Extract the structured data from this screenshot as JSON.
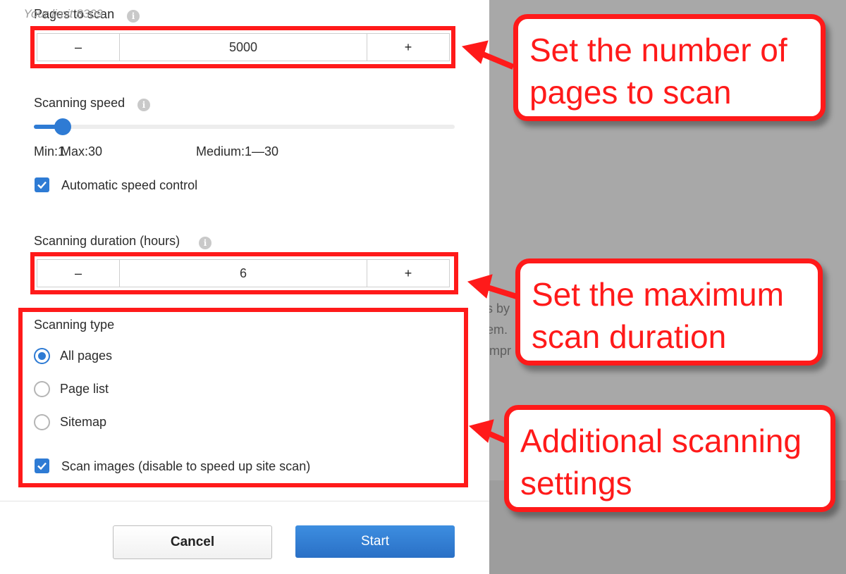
{
  "pages_to_scan": {
    "label": "Pages to scan",
    "limit_text": "Your limit 8309",
    "decrement_label": "–",
    "value": "5000",
    "increment_label": "+"
  },
  "scanning_speed": {
    "label": "Scanning speed",
    "level": 1,
    "min_label": "Min:1",
    "medium_label": "Medium:1—30",
    "max_label": "Max:30",
    "auto_label": "Automatic speed control",
    "auto_checked": true
  },
  "scanning_duration": {
    "label": "Scanning duration (hours)",
    "decrement_label": "–",
    "value": "6",
    "increment_label": "+"
  },
  "scanning_type": {
    "label": "Scanning type",
    "options": [
      {
        "label": "All pages",
        "selected": true
      },
      {
        "label": "Page list",
        "selected": false
      },
      {
        "label": "Sitemap",
        "selected": false
      }
    ],
    "scan_images_label": "Scan images (disable to speed up site scan)",
    "scan_images_checked": true
  },
  "footer": {
    "cancel_label": "Cancel",
    "start_label": "Start"
  },
  "background_text": [
    "s by",
    "em.",
    "impr"
  ],
  "callouts": {
    "pages": [
      "Set the number of",
      "pages to scan"
    ],
    "duration": [
      "Set the maximum",
      "scan duration"
    ],
    "settings": [
      "Additional scanning",
      "settings"
    ]
  },
  "colors": {
    "accent": "#2e7bd4",
    "annotation": "#ff1a1a"
  },
  "icons": {
    "info": "info-icon",
    "check": "checkmark-icon"
  }
}
